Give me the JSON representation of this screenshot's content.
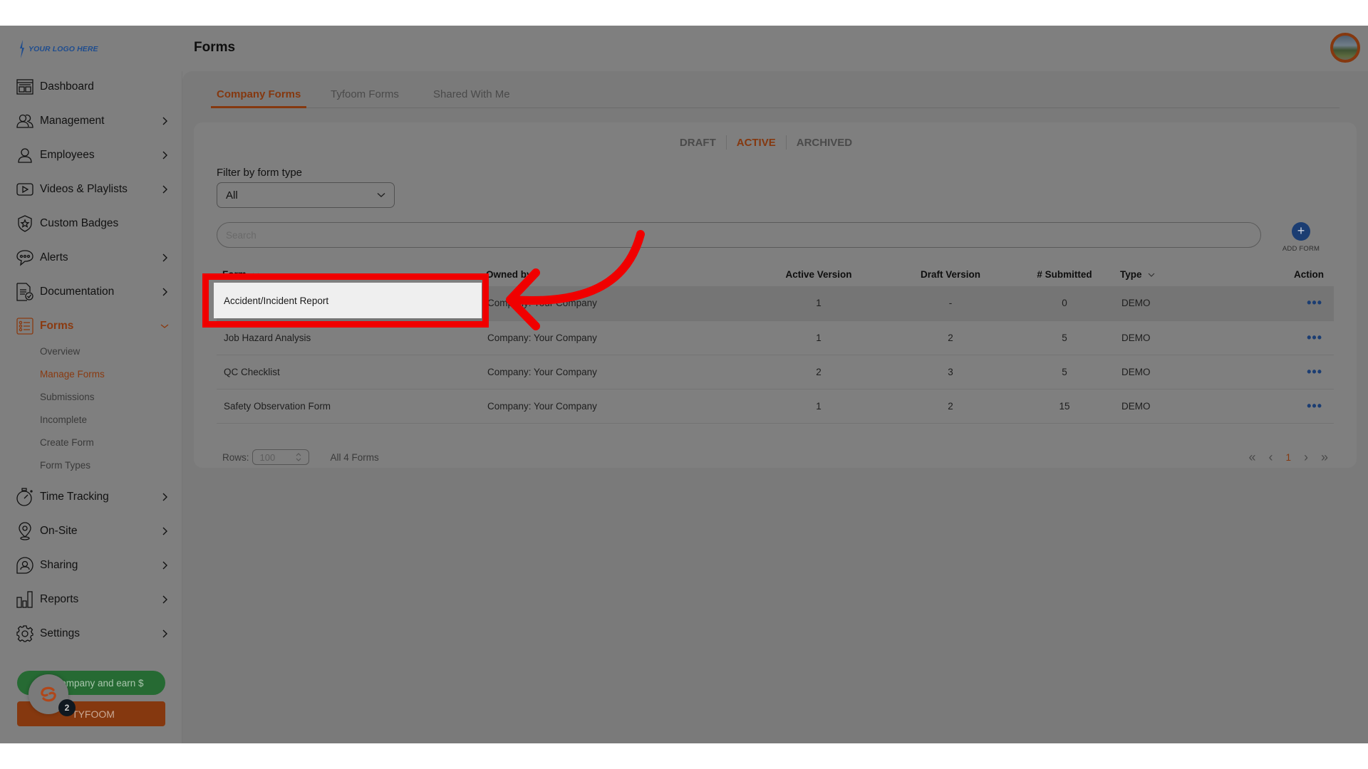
{
  "sidebar": {
    "logo_text": "YOUR LOGO HERE",
    "items": [
      {
        "label": "Dashboard",
        "icon": "dashboard-icon",
        "has_chevron": false
      },
      {
        "label": "Management",
        "icon": "users-icon",
        "has_chevron": true
      },
      {
        "label": "Employees",
        "icon": "user-icon",
        "has_chevron": true
      },
      {
        "label": "Videos & Playlists",
        "icon": "video-play-icon",
        "has_chevron": true
      },
      {
        "label": "Custom Badges",
        "icon": "badge-shield-icon",
        "has_chevron": false
      },
      {
        "label": "Alerts",
        "icon": "chat-bubble-icon",
        "has_chevron": true
      },
      {
        "label": "Documentation",
        "icon": "document-check-icon",
        "has_chevron": true
      },
      {
        "label": "Forms",
        "icon": "list-icon",
        "has_chevron": true,
        "expanded": true,
        "active": true
      },
      {
        "label": "Time Tracking",
        "icon": "stopwatch-icon",
        "has_chevron": true
      },
      {
        "label": "On-Site",
        "icon": "location-pin-icon",
        "has_chevron": true
      },
      {
        "label": "Sharing",
        "icon": "share-user-icon",
        "has_chevron": true
      },
      {
        "label": "Reports",
        "icon": "bar-chart-icon",
        "has_chevron": true
      },
      {
        "label": "Settings",
        "icon": "gear-icon",
        "has_chevron": true
      }
    ],
    "forms_subitems": [
      {
        "label": "Overview",
        "active": false
      },
      {
        "label": "Manage Forms",
        "active": true
      },
      {
        "label": "Submissions",
        "active": false
      },
      {
        "label": "Incomplete",
        "active": false
      },
      {
        "label": "Create Form",
        "active": false
      },
      {
        "label": "Form Types",
        "active": false
      }
    ],
    "refer_button": "Refer a company and earn $",
    "refer_button_visible": "company and earn $",
    "tyfoom_button": "TYFOOM",
    "notification_count": "2"
  },
  "header": {
    "title": "Forms",
    "avatar": "user-avatar"
  },
  "tabs": [
    {
      "label": "Company Forms",
      "active": true
    },
    {
      "label": "Tyfoom Forms",
      "active": false
    },
    {
      "label": "Shared With Me",
      "active": false
    }
  ],
  "status_filters": [
    {
      "label": "DRAFT",
      "active": false
    },
    {
      "label": "ACTIVE",
      "active": true
    },
    {
      "label": "ARCHIVED",
      "active": false
    }
  ],
  "filter": {
    "label": "Filter by form type",
    "value": "All"
  },
  "search": {
    "placeholder": "Search",
    "value": ""
  },
  "add_form": {
    "label": "ADD FORM",
    "icon": "+"
  },
  "table": {
    "columns": [
      "Form",
      "Owned by",
      "Active Version",
      "Draft Version",
      "# Submitted",
      "Type",
      "Action"
    ],
    "rows": [
      {
        "form": "Accident/Incident Report",
        "owned_by": "Company: Your Company",
        "active_version": "1",
        "draft_version": "-",
        "submitted": "0",
        "type": "DEMO",
        "action": "•••"
      },
      {
        "form": "Job Hazard Analysis",
        "owned_by": "Company: Your Company",
        "active_version": "1",
        "draft_version": "2",
        "submitted": "5",
        "type": "DEMO",
        "action": "•••"
      },
      {
        "form": "QC Checklist",
        "owned_by": "Company: Your Company",
        "active_version": "2",
        "draft_version": "3",
        "submitted": "5",
        "type": "DEMO",
        "action": "•••"
      },
      {
        "form": "Safety Observation Form",
        "owned_by": "Company: Your Company",
        "active_version": "1",
        "draft_version": "2",
        "submitted": "15",
        "type": "DEMO",
        "action": "•••"
      }
    ]
  },
  "footer": {
    "rows_label": "Rows:",
    "rows_value": "100",
    "count": "All 4 Forms",
    "page": "1",
    "first": "«",
    "prev": "‹",
    "next": "›",
    "last": "»"
  },
  "annotation": {
    "highlighted_text": "Accident/Incident Report",
    "box_color": "#f00000"
  },
  "colors": {
    "accent": "#85380f",
    "brand_blue": "#1b3d72",
    "refer_green": "#266a33"
  }
}
